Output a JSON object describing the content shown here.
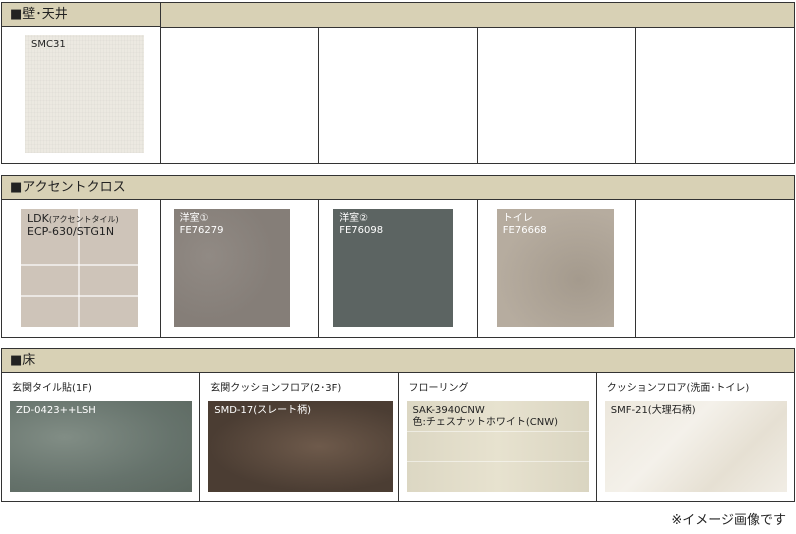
{
  "sections": {
    "wall_ceiling": {
      "title": "■壁･天井",
      "items": [
        {
          "code": "SMC31"
        }
      ]
    },
    "accent_cloth": {
      "title": "■アクセントクロス",
      "items": [
        {
          "label": "LDK",
          "label_small": "(アクセントタイル)",
          "code": "ECP-630/STG1N"
        },
        {
          "label": "洋室①",
          "code": "FE76279"
        },
        {
          "label": "洋室②",
          "code": "FE76098"
        },
        {
          "label": "トイレ",
          "code": "FE76668"
        }
      ]
    },
    "floor": {
      "title": "■床",
      "items": [
        {
          "caption": "玄関タイル貼(1F)",
          "code": "ZD-0423++LSH"
        },
        {
          "caption": "玄関クッションフロア(2･3F)",
          "code": "SMD-17(スレート柄)"
        },
        {
          "caption": "フローリング",
          "code": "SAK-3940CNW",
          "color_line": "色:チェスナットホワイト(CNW)"
        },
        {
          "caption": "クッションフロア(洗面･トイレ)",
          "code": "SMF-21(大理石柄)"
        }
      ]
    }
  },
  "footnote": "※イメージ画像です"
}
